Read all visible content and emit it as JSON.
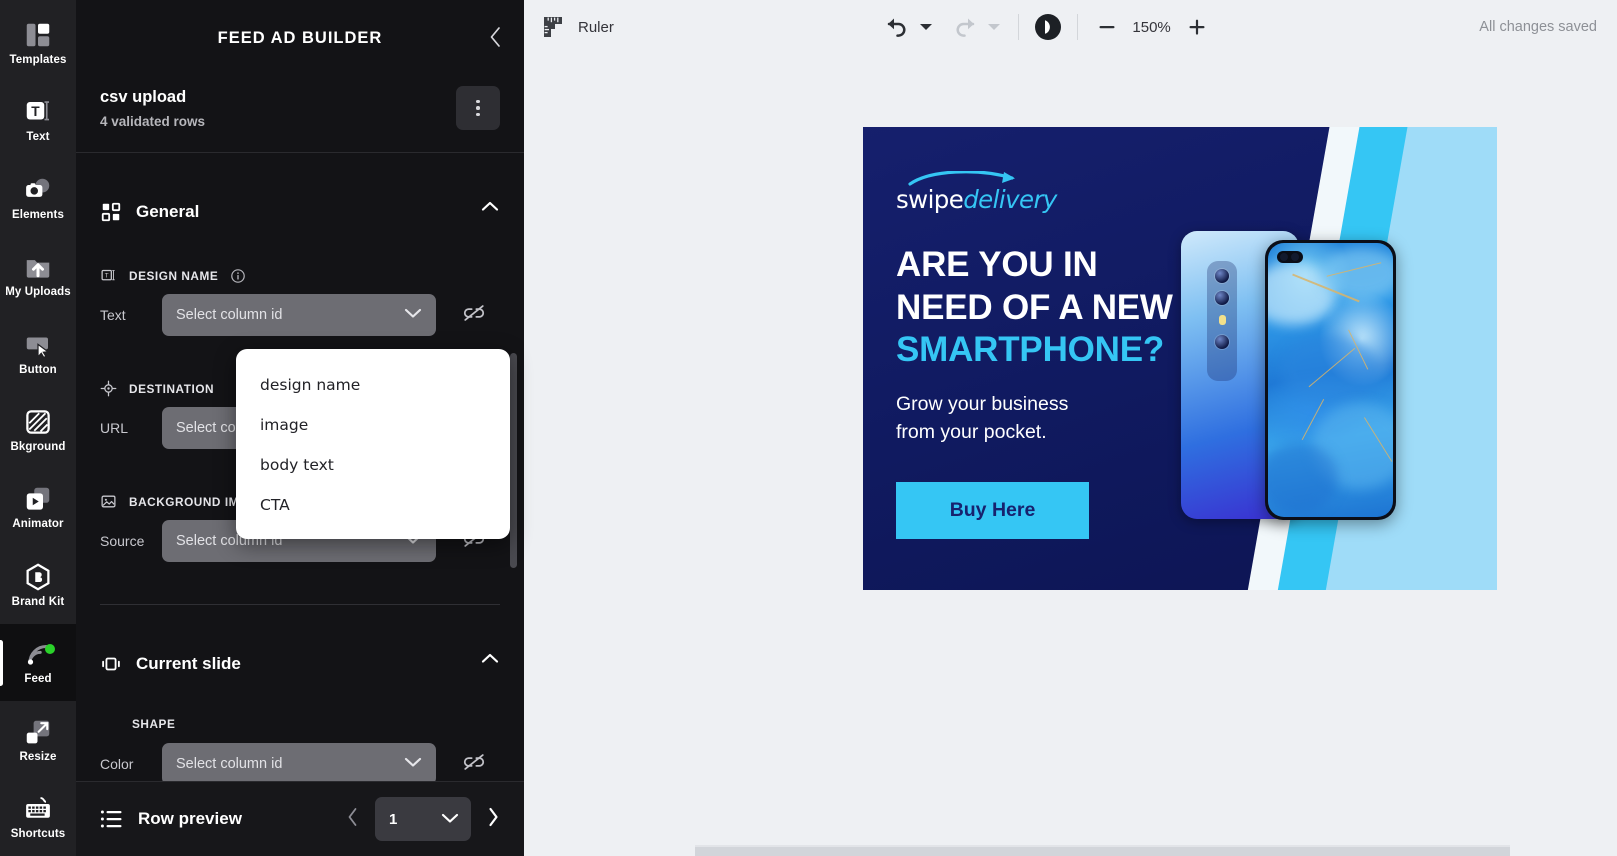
{
  "rail": {
    "items": [
      {
        "label": "Templates",
        "icon": "templates-icon",
        "active": false
      },
      {
        "label": "Text",
        "icon": "text-icon",
        "active": false
      },
      {
        "label": "Elements",
        "icon": "elements-icon",
        "active": false
      },
      {
        "label": "My Uploads",
        "icon": "upload-icon",
        "active": false
      },
      {
        "label": "Button",
        "icon": "button-icon",
        "active": false
      },
      {
        "label": "Bkground",
        "icon": "background-icon",
        "active": false
      },
      {
        "label": "Animator",
        "icon": "animator-icon",
        "active": false
      },
      {
        "label": "Brand Kit",
        "icon": "brand-kit-icon",
        "active": false
      },
      {
        "label": "Feed",
        "icon": "feed-icon",
        "active": true
      },
      {
        "label": "Resize",
        "icon": "resize-icon",
        "active": false
      },
      {
        "label": "Shortcuts",
        "icon": "keyboard-icon",
        "active": false
      }
    ]
  },
  "panel": {
    "title": "FEED AD BUILDER",
    "feed": {
      "name": "csv upload",
      "meta": "4 validated rows"
    },
    "sections": {
      "general": {
        "title": "General",
        "design_name_label": "DESIGN NAME",
        "design_name_row_label": "Text",
        "design_name_value": "Select column id",
        "destination_label": "DESTINATION",
        "destination_row_label": "URL",
        "background_label": "BACKGROUND IMAGE",
        "background_row_label": "Source"
      },
      "current_slide": {
        "title": "Current slide",
        "shape_label": "SHAPE",
        "color_row_label": "Color",
        "color_value": "Select column id"
      }
    },
    "dropdown": {
      "options": [
        "design name",
        "image",
        "body text",
        "CTA"
      ]
    },
    "row_preview": {
      "title": "Row preview",
      "current": "1"
    }
  },
  "toolbar": {
    "ruler_label": "Ruler",
    "zoom_value": "150%",
    "save_status": "All changes saved",
    "undo_icon": "undo-icon",
    "redo_icon": "redo-icon",
    "play_icon": "play-icon",
    "zoom_out_icon": "minus-icon",
    "zoom_in_icon": "plus-icon"
  },
  "ad": {
    "logo_primary": "swipe",
    "logo_secondary": "delivery",
    "headline_line1": "ARE YOU IN",
    "headline_line2": "NEED OF A NEW",
    "headline_line3": "SMARTPHONE?",
    "body_line1": "Grow your business",
    "body_line2": "from your pocket.",
    "cta_label": "Buy Here",
    "colors": {
      "navy": "#121a66",
      "cyan": "#35c6f4",
      "light_blue": "#9fdcf8",
      "white": "#ffffff"
    }
  }
}
